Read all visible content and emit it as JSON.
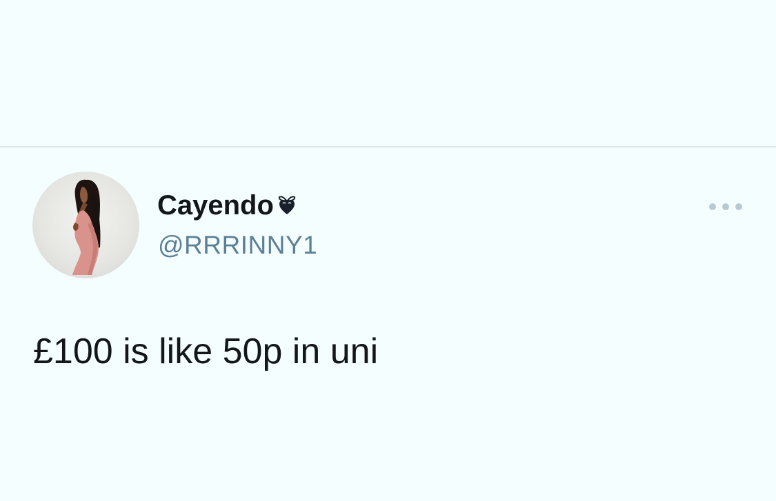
{
  "tweet": {
    "author": {
      "display_name": "Cayendo",
      "handle": "@RRRINNY1",
      "name_emoji_icon": "heart-with-bow-icon",
      "avatar_icon": "profile-photo"
    },
    "text": "£100 is like 50p in uni",
    "more_icon": "more-dots-icon"
  },
  "colors": {
    "background": "#f5fefe",
    "divider": "#dfe7ea",
    "name_text": "#14171a",
    "handle_text": "#5b7f95",
    "more_dots": "#b8c9d6"
  }
}
